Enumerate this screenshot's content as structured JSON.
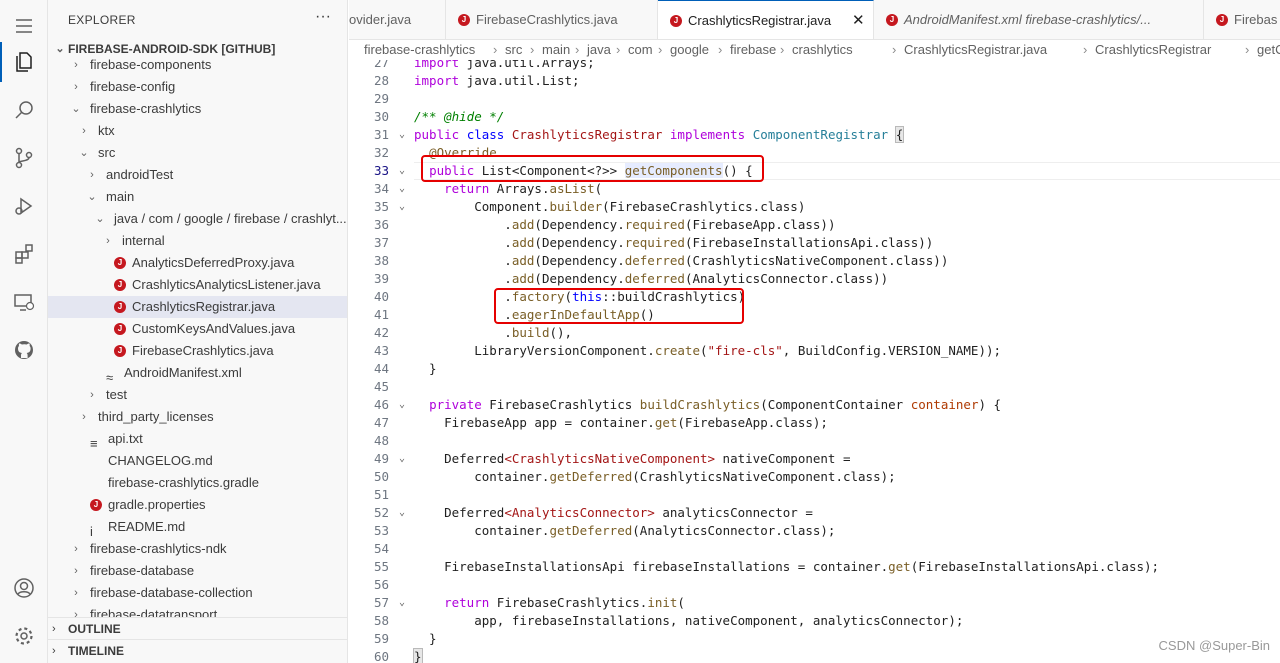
{
  "activity": {
    "items": [
      "menu-icon",
      "files-icon",
      "search-icon",
      "source-control-icon",
      "run-debug-icon",
      "extensions-icon",
      "remote-explorer-icon",
      "github-icon",
      "account-icon",
      "settings-gear-icon"
    ]
  },
  "sidebar": {
    "title": "EXPLORER",
    "more": "···",
    "root": "FIREBASE-ANDROID-SDK [GITHUB]",
    "tree": [
      {
        "label": "firebase-components",
        "chev": "›",
        "indent": 1
      },
      {
        "label": "firebase-config",
        "chev": "›",
        "indent": 1
      },
      {
        "label": "firebase-crashlytics",
        "chev": "⌄",
        "indent": 1
      },
      {
        "label": "ktx",
        "chev": "›",
        "indent": 2
      },
      {
        "label": "src",
        "chev": "⌄",
        "indent": 2
      },
      {
        "label": "androidTest",
        "chev": "›",
        "indent": 3
      },
      {
        "label": "main",
        "chev": "⌄",
        "indent": 3
      },
      {
        "label": "java / com / google / firebase / crashlyt...",
        "chev": "⌄",
        "indent": 4
      },
      {
        "label": "internal",
        "chev": "›",
        "indent": 5
      },
      {
        "label": "AnalyticsDeferredProxy.java",
        "icon": "java",
        "indent": 5
      },
      {
        "label": "CrashlyticsAnalyticsListener.java",
        "icon": "java",
        "indent": 5
      },
      {
        "label": "CrashlyticsRegistrar.java",
        "icon": "java",
        "indent": 5,
        "selected": true
      },
      {
        "label": "CustomKeysAndValues.java",
        "icon": "java",
        "indent": 5
      },
      {
        "label": "FirebaseCrashlytics.java",
        "icon": "java",
        "indent": 5
      },
      {
        "label": "AndroidManifest.xml",
        "icon": "xml",
        "indent": 4
      },
      {
        "label": "test",
        "chev": "›",
        "indent": 3
      },
      {
        "label": "third_party_licenses",
        "chev": "›",
        "indent": 2
      },
      {
        "label": "api.txt",
        "icon": "txt",
        "indent": 2
      },
      {
        "label": "CHANGELOG.md",
        "icon": "md",
        "indent": 2
      },
      {
        "label": "firebase-crashlytics.gradle",
        "icon": "gradle",
        "indent": 2
      },
      {
        "label": "gradle.properties",
        "icon": "java",
        "indent": 2
      },
      {
        "label": "README.md",
        "icon": "info",
        "indent": 2
      },
      {
        "label": "firebase-crashlytics-ndk",
        "chev": "›",
        "indent": 1
      },
      {
        "label": "firebase-database",
        "chev": "›",
        "indent": 1
      },
      {
        "label": "firebase-database-collection",
        "chev": "›",
        "indent": 1
      },
      {
        "label": "firebase-datatransport",
        "chev": "›",
        "indent": 1
      }
    ],
    "outline": "OUTLINE",
    "timeline": "TIMELINE"
  },
  "tabs": [
    {
      "label": "ovider.java",
      "active": false
    },
    {
      "label": "FirebaseCrashlytics.java",
      "active": false
    },
    {
      "label": "CrashlyticsRegistrar.java",
      "active": true,
      "close": "✕"
    },
    {
      "label": "AndroidManifest.xml  firebase-crashlytics/...",
      "active": false,
      "italic": true
    },
    {
      "label": "Firebas",
      "active": false
    }
  ],
  "breadcrumb": [
    "firebase-crashlytics",
    "src",
    "main",
    "java",
    "com",
    "google",
    "firebase",
    "crashlytics",
    "CrashlyticsRegistrar.java",
    "CrashlyticsRegistrar",
    "getC"
  ],
  "editor": {
    "lines": [
      {
        "n": "27",
        "fold": "",
        "html": "<span class='kw'>import</span> java.util.Arrays;"
      },
      {
        "n": "28",
        "fold": "",
        "html": "<span class='kw'>import</span> java.util.List;"
      },
      {
        "n": "29",
        "fold": "",
        "html": ""
      },
      {
        "n": "30",
        "fold": "",
        "html": "<span class='cm'>/** @hide */</span>"
      },
      {
        "n": "31",
        "fold": "⌄",
        "html": "<span class='kw'>public</span> <span class='kw2'>class</span> <span class='st'>CrashlyticsRegistrar</span> <span class='kw'>implements</span> <span class='ty'>ComponentRegistrar</span> <span style='background:#e7e7e7;outline:1px solid #b9b9b9'>{</span>"
      },
      {
        "n": "32",
        "fold": "",
        "html": "  <span class='fn'>@Override</span>"
      },
      {
        "n": "33",
        "fold": "⌄",
        "html": "  <span class='kw'>public</span> List&lt;Component&lt;?&gt;&gt; <span class='fn' style='background:#e6ecff'>getComponents</span>() {",
        "cur": true
      },
      {
        "n": "34",
        "fold": "⌄",
        "html": "    <span class='kw'>return</span> Arrays.<span class='fn'>asList</span>("
      },
      {
        "n": "35",
        "fold": "⌄",
        "html": "        Component.<span class='fn'>builder</span>(FirebaseCrashlytics.class)"
      },
      {
        "n": "36",
        "fold": "",
        "html": "            .<span class='fn'>add</span>(Dependency.<span class='fn'>required</span>(FirebaseApp.class))"
      },
      {
        "n": "37",
        "fold": "",
        "html": "            .<span class='fn'>add</span>(Dependency.<span class='fn'>required</span>(FirebaseInstallationsApi.class))"
      },
      {
        "n": "38",
        "fold": "",
        "html": "            .<span class='fn'>add</span>(Dependency.<span class='fn'>deferred</span>(CrashlyticsNativeComponent.class))"
      },
      {
        "n": "39",
        "fold": "",
        "html": "            .<span class='fn'>add</span>(Dependency.<span class='fn'>deferred</span>(AnalyticsConnector.class))"
      },
      {
        "n": "40",
        "fold": "",
        "html": "            .<span class='fn'>factory</span>(<span class='kw2'>this</span>::buildCrashlytics)"
      },
      {
        "n": "41",
        "fold": "",
        "html": "            .<span class='fn'>eagerInDefaultApp</span>()"
      },
      {
        "n": "42",
        "fold": "",
        "html": "            .<span class='fn'>build</span>(),"
      },
      {
        "n": "43",
        "fold": "",
        "html": "        LibraryVersionComponent.<span class='fn'>create</span>(<span class='st'>\"fire-cls\"</span>, BuildConfig.VERSION_NAME));"
      },
      {
        "n": "44",
        "fold": "",
        "html": "  }"
      },
      {
        "n": "45",
        "fold": "",
        "html": ""
      },
      {
        "n": "46",
        "fold": "⌄",
        "html": "  <span class='kw'>private</span> FirebaseCrashlytics <span class='fn'>buildCrashlytics</span>(ComponentContainer <span class='gh'>container</span>) {"
      },
      {
        "n": "47",
        "fold": "",
        "html": "    FirebaseApp app = container.<span class='fn'>get</span>(FirebaseApp.class);"
      },
      {
        "n": "48",
        "fold": "",
        "html": ""
      },
      {
        "n": "49",
        "fold": "⌄",
        "html": "    Deferred<span class='st'>&lt;CrashlyticsNativeComponent&gt;</span> nativeComponent ="
      },
      {
        "n": "50",
        "fold": "",
        "html": "        container.<span class='fn'>getDeferred</span>(CrashlyticsNativeComponent.class);"
      },
      {
        "n": "51",
        "fold": "",
        "html": ""
      },
      {
        "n": "52",
        "fold": "⌄",
        "html": "    Deferred<span class='st'>&lt;AnalyticsConnector&gt;</span> analyticsConnector ="
      },
      {
        "n": "53",
        "fold": "",
        "html": "        container.<span class='fn'>getDeferred</span>(AnalyticsConnector.class);"
      },
      {
        "n": "54",
        "fold": "",
        "html": ""
      },
      {
        "n": "55",
        "fold": "",
        "html": "    FirebaseInstallationsApi firebaseInstallations = container.<span class='fn'>get</span>(FirebaseInstallationsApi.class);"
      },
      {
        "n": "56",
        "fold": "",
        "html": ""
      },
      {
        "n": "57",
        "fold": "⌄",
        "html": "    <span class='kw'>return</span> FirebaseCrashlytics.<span class='fn'>init</span>("
      },
      {
        "n": "58",
        "fold": "",
        "html": "        app, firebaseInstallations, nativeComponent, analyticsConnector);"
      },
      {
        "n": "59",
        "fold": "",
        "html": "  }"
      },
      {
        "n": "60",
        "fold": "",
        "html": "<span style='background:#e7e7e7;outline:1px solid #b9b9b9'>}</span>"
      }
    ]
  },
  "watermark": "CSDN @Super-Bin",
  "colors": {
    "accent": "#005fb8",
    "highlight_box": "#e50000",
    "java_icon": "#c5181f"
  }
}
